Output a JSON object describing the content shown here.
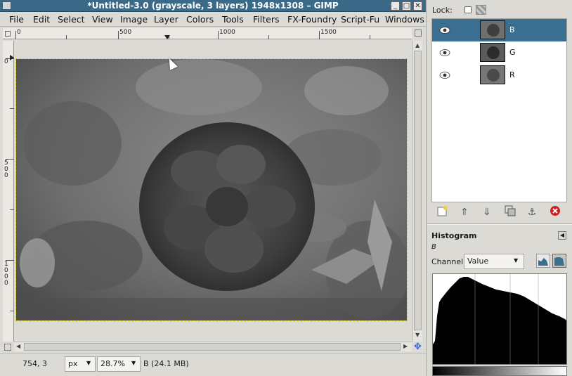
{
  "window": {
    "title": "*Untitled-3.0 (grayscale, 3 layers) 1948x1308 – GIMP",
    "min_label": "_",
    "max_label": "□",
    "close_label": "✕"
  },
  "menu": [
    "File",
    "Edit",
    "Select",
    "View",
    "Image",
    "Layer",
    "Colors",
    "Tools",
    "Filters",
    "FX-Foundry",
    "Script-Fu",
    "Windows"
  ],
  "rulers": {
    "h_labels": [
      "0",
      "500",
      "1000",
      "1500"
    ],
    "v_labels": [
      "0",
      "500",
      "1000"
    ]
  },
  "status": {
    "coords": "754, 3",
    "unit": "px",
    "zoom": "28.7%",
    "info": "B (24.1 MB)"
  },
  "layers_panel": {
    "lock_label": "Lock:",
    "layers": [
      {
        "name": "B",
        "selected": true
      },
      {
        "name": "G",
        "selected": false
      },
      {
        "name": "R",
        "selected": false
      }
    ]
  },
  "histogram": {
    "title": "Histogram",
    "layer_name": "B",
    "channel_label": "Channel:",
    "channel_value": "Value"
  },
  "icons": {
    "new_layer": "new-layer-icon",
    "raise": "raise-layer-icon",
    "lower": "lower-layer-icon",
    "duplicate": "duplicate-layer-icon",
    "anchor": "anchor-icon",
    "delete": "delete-icon"
  },
  "colors": {
    "titlebar": "#3a6a88",
    "selection": "#3b6f92",
    "delete_red": "#d02020"
  }
}
